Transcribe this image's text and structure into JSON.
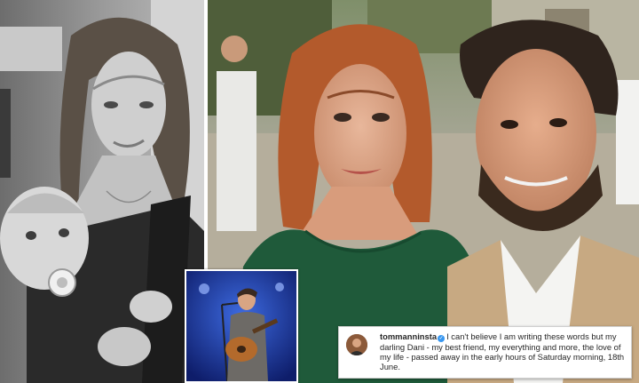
{
  "photos": {
    "left": {
      "subject": "woman-holding-baby-bw"
    },
    "right": {
      "subject": "couple-selfie-at-wedding"
    },
    "inset": {
      "subject": "singer-with-guitar-on-stage"
    }
  },
  "caption": {
    "username": "tommanninsta",
    "verified": true,
    "text": "I can't believe I am writing these words but my darling Dani - my best friend, my everything and more, the love of my life - passed away in the early hours of Saturday morning, 18th June."
  },
  "colors": {
    "verified_badge": "#3897f0",
    "stage_blue": "#1f3fb0",
    "dress_green": "#1f5a3a"
  }
}
